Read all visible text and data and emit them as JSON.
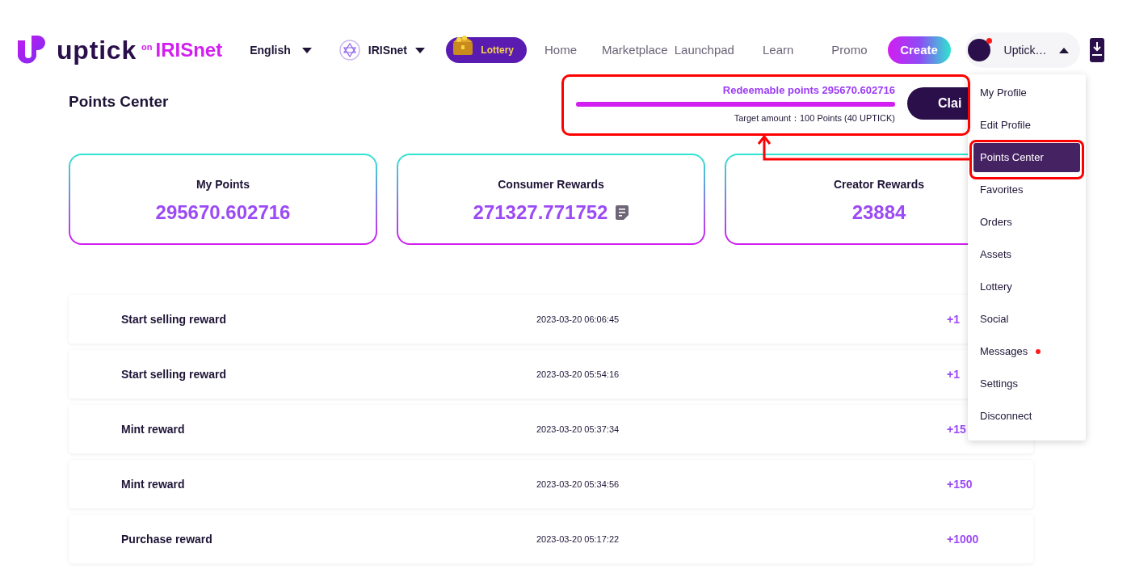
{
  "header": {
    "logo": {
      "wordmark": "uptick",
      "on": "on",
      "network": "IRISnet"
    },
    "language": "English",
    "network": "IRISnet",
    "lottery": "Lottery",
    "nav": [
      {
        "label": "Home"
      },
      {
        "label": "Marketplace"
      },
      {
        "label": "Launchpad"
      },
      {
        "label": "Learn"
      },
      {
        "label": "Promo"
      }
    ],
    "create": "Create",
    "user": {
      "name": "Uptick…",
      "notification": true
    }
  },
  "title": "Points Center",
  "redeem": {
    "label": "Redeemable points 295670.602716",
    "level": 1,
    "target": "Target amount：100 Points (40 UPTICK)",
    "button": "Clai"
  },
  "cards": [
    {
      "label": "My Points",
      "value": "295670.602716",
      "details": false
    },
    {
      "label": "Consumer Rewards",
      "value": "271327.771752",
      "details": true
    },
    {
      "label": "Creator Rewards",
      "value": "23884",
      "details": false
    }
  ],
  "rows": [
    {
      "label": "Start selling reward",
      "time": "2023-03-20 06:06:45",
      "points": "+1"
    },
    {
      "label": "Start selling reward",
      "time": "2023-03-20 05:54:16",
      "points": "+1"
    },
    {
      "label": "Mint reward",
      "time": "2023-03-20 05:37:34",
      "points": "+15"
    },
    {
      "label": "Mint reward",
      "time": "2023-03-20 05:34:56",
      "points": "+150"
    },
    {
      "label": "Purchase reward",
      "time": "2023-03-20 05:17:22",
      "points": "+1000"
    }
  ],
  "menu": [
    {
      "label": "My Profile",
      "selected": false,
      "dot": false
    },
    {
      "label": "Edit Profile",
      "selected": false,
      "dot": false
    },
    {
      "label": "Points Center",
      "selected": true,
      "dot": false
    },
    {
      "label": "Favorites",
      "selected": false,
      "dot": false
    },
    {
      "label": "Orders",
      "selected": false,
      "dot": false
    },
    {
      "label": "Assets",
      "selected": false,
      "dot": false
    },
    {
      "label": "Lottery",
      "selected": false,
      "dot": false
    },
    {
      "label": "Social",
      "selected": false,
      "dot": false
    },
    {
      "label": "Messages",
      "selected": false,
      "dot": true
    },
    {
      "label": "Settings",
      "selected": false,
      "dot": false
    },
    {
      "label": "Disconnect",
      "selected": false,
      "dot": false
    }
  ]
}
